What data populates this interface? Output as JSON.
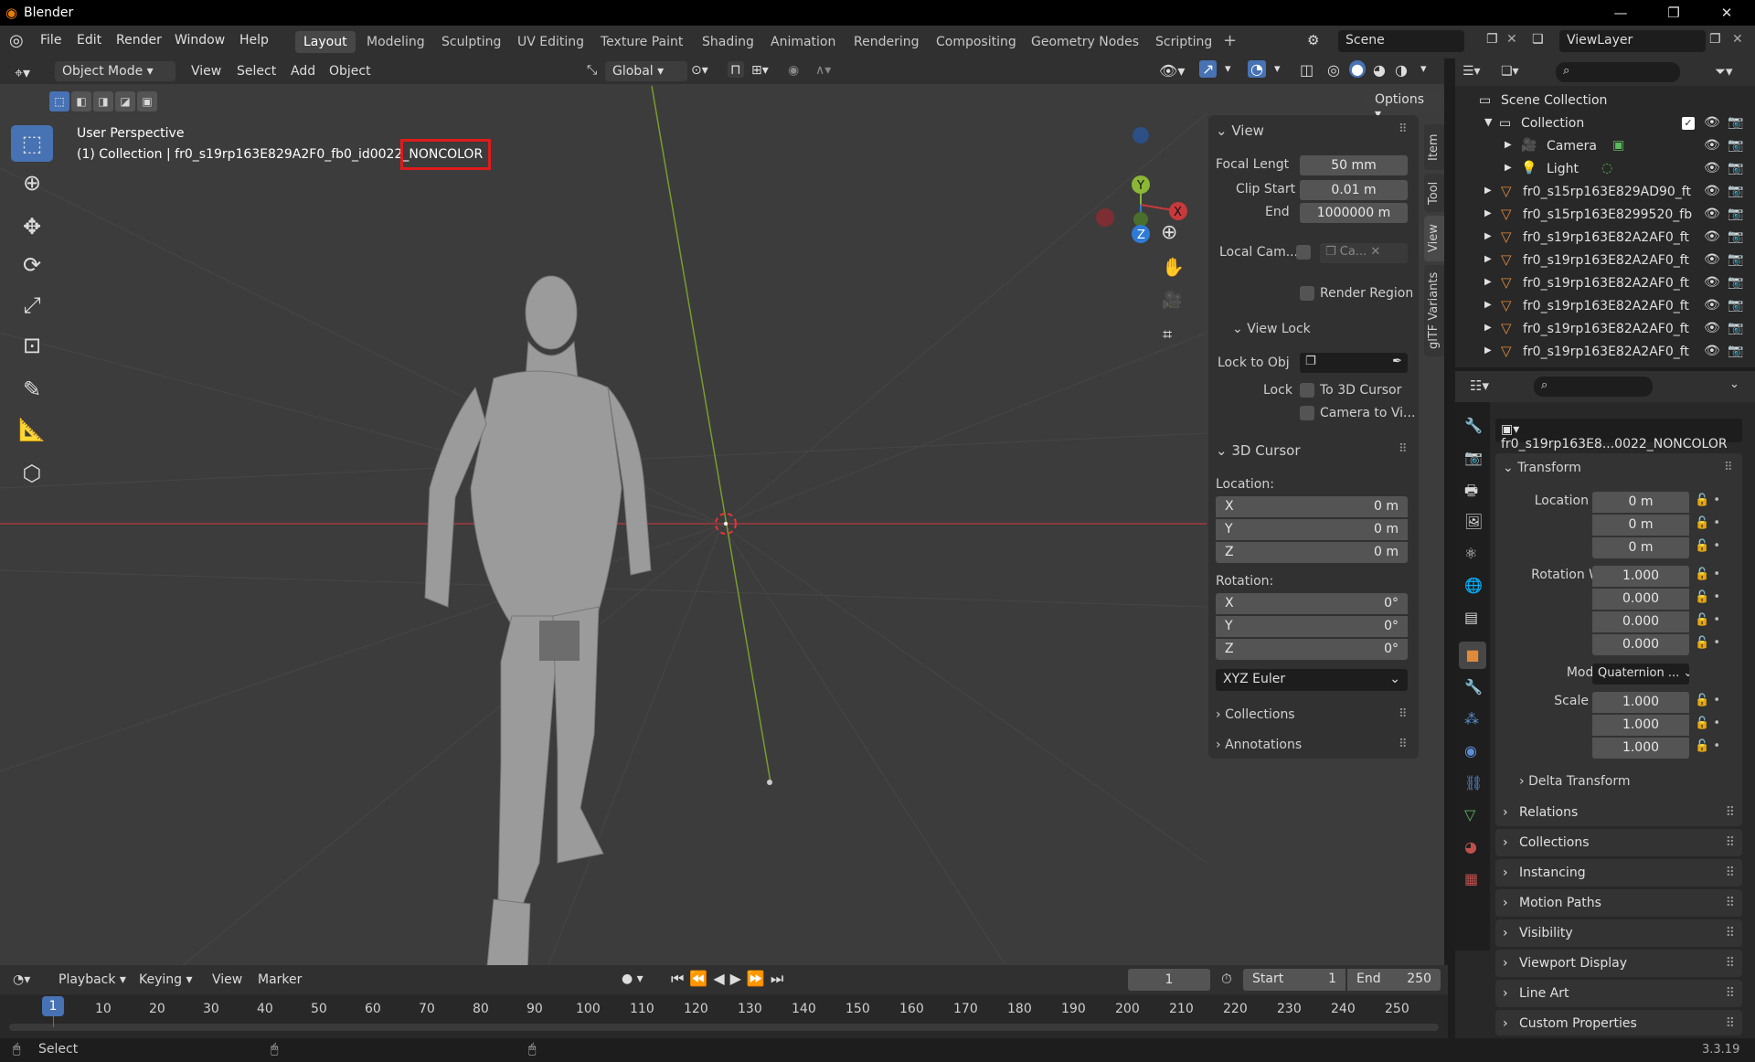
{
  "window": {
    "title": "Blender",
    "controls": [
      "—",
      "❐",
      "✕"
    ]
  },
  "menus": [
    "File",
    "Edit",
    "Render",
    "Window",
    "Help"
  ],
  "workspaces": [
    "Layout",
    "Modeling",
    "Sculpting",
    "UV Editing",
    "Texture Paint",
    "Shading",
    "Animation",
    "Rendering",
    "Compositing",
    "Geometry Nodes",
    "Scripting"
  ],
  "active_workspace": "Layout",
  "scene": "Scene",
  "view_layer": "ViewLayer",
  "viewport": {
    "mode": "Object Mode",
    "menus": [
      "View",
      "Select",
      "Add",
      "Object"
    ],
    "orientation": "Global",
    "options": "Options",
    "overlay_line1": "User Perspective",
    "overlay_line2_prefix": "(1) Collection | fr0_s19rp163E829A2F0_fb0_id0022_",
    "overlay_line2_highlight": "NONCOLOR",
    "gizmo": {
      "y": "Y",
      "x": "X",
      "z": "Z"
    }
  },
  "npanel": {
    "tabs": [
      "Item",
      "Tool",
      "View",
      "glTF Variants"
    ],
    "view": {
      "title": "View",
      "focal_label": "Focal Lengt",
      "focal_value": "50 mm",
      "clip_start_label": "Clip Start",
      "clip_start_value": "0.01 m",
      "end_label": "End",
      "end_value": "1000000 m",
      "local_cam_label": "Local Cam...",
      "local_cam_value": "Ca...",
      "render_region": "Render Region"
    },
    "view_lock": {
      "title": "View Lock",
      "lock_to_obj": "Lock to Obj",
      "lock_label": "Lock",
      "to_cursor": "To 3D Cursor",
      "camera_to_view": "Camera to Vi..."
    },
    "cursor": {
      "title": "3D Cursor",
      "location_label": "Location:",
      "rotation_label": "Rotation:",
      "loc": [
        {
          "axis": "X",
          "value": "0 m"
        },
        {
          "axis": "Y",
          "value": "0 m"
        },
        {
          "axis": "Z",
          "value": "0 m"
        }
      ],
      "rot": [
        {
          "axis": "X",
          "value": "0°"
        },
        {
          "axis": "Y",
          "value": "0°"
        },
        {
          "axis": "Z",
          "value": "0°"
        }
      ],
      "rot_mode": "XYZ Euler"
    },
    "collections": "Collections",
    "annotations": "Annotations"
  },
  "outliner": {
    "scene_collection": "Scene Collection",
    "collection": "Collection",
    "items": [
      "Camera",
      "Light"
    ],
    "objects": [
      "fr0_s15rp163E829AD90_ft",
      "fr0_s15rp163E8299520_fb",
      "fr0_s19rp163E82A2AF0_ft",
      "fr0_s19rp163E82A2AF0_ft",
      "fr0_s19rp163E82A2AF0_ft",
      "fr0_s19rp163E82A2AF0_ft",
      "fr0_s19rp163E82A2AF0_ft",
      "fr0_s19rp163E82A2AF0_ft"
    ]
  },
  "properties": {
    "object_name": "fr0_s19rp163E8...0022_NONCOLOR",
    "transform_title": "Transform",
    "location": [
      {
        "label": "Location X",
        "value": "0 m"
      },
      {
        "label": "Y",
        "value": "0 m"
      },
      {
        "label": "Z",
        "value": "0 m"
      }
    ],
    "rotation": [
      {
        "label": "Rotation W",
        "value": "1.000"
      },
      {
        "label": "X",
        "value": "0.000"
      },
      {
        "label": "Y",
        "value": "0.000"
      },
      {
        "label": "Z",
        "value": "0.000"
      }
    ],
    "mode_label": "Mode",
    "mode_value": "Quaternion ...",
    "scale": [
      {
        "label": "Scale X",
        "value": "1.000"
      },
      {
        "label": "Y",
        "value": "1.000"
      },
      {
        "label": "Z",
        "value": "1.000"
      }
    ],
    "delta": "Delta Transform",
    "sections": [
      "Relations",
      "Collections",
      "Instancing",
      "Motion Paths",
      "Visibility",
      "Viewport Display",
      "Line Art",
      "Custom Properties"
    ]
  },
  "timeline": {
    "menus": [
      "Playback",
      "Keying",
      "View",
      "Marker"
    ],
    "current_frame": "1",
    "start_label": "Start",
    "start": "1",
    "end_label": "End",
    "end": "250",
    "ticks": [
      "1",
      "10",
      "20",
      "30",
      "40",
      "50",
      "60",
      "70",
      "80",
      "90",
      "100",
      "110",
      "120",
      "130",
      "140",
      "150",
      "160",
      "170",
      "180",
      "190",
      "200",
      "210",
      "220",
      "230",
      "240",
      "250"
    ]
  },
  "status": {
    "left": "Select",
    "version": "3.3.19"
  },
  "colors": {
    "accent": "#4772b3",
    "highlight_box": "#e01b1b",
    "x_axis": "#c8393c",
    "y_axis": "#8bb636",
    "z_axis": "#2e7bd6"
  }
}
